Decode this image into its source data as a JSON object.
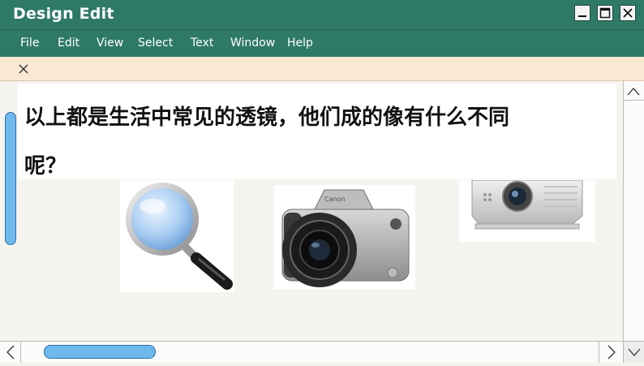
{
  "window": {
    "title": "Design Edit"
  },
  "menu": {
    "items": [
      "File",
      "Edit",
      "View",
      "Select",
      "Text",
      "Window",
      "Help"
    ]
  },
  "slide": {
    "heading_line1": "以上都是生活中常见的透镜，他们成的像有什么不同",
    "heading_line2": "呢？"
  },
  "images": [
    {
      "name": "magnifying-glass"
    },
    {
      "name": "camera",
      "brand": "Canon"
    },
    {
      "name": "projector"
    }
  ],
  "colors": {
    "titlebar": "#2f7a66",
    "tabstrip": "#fbe8d3",
    "scroll_thumb": "#6fb8ec"
  }
}
